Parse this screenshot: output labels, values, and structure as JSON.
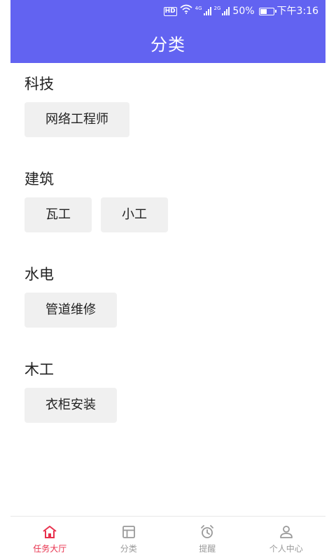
{
  "status_bar": {
    "hd": "HD",
    "net1": "4G",
    "net2": "2G",
    "battery_percent": "50%",
    "battery_level": 0.5,
    "time": "下午3:16"
  },
  "header": {
    "title": "分类"
  },
  "sections": [
    {
      "title": "科技",
      "items": [
        "网络工程师"
      ]
    },
    {
      "title": "建筑",
      "items": [
        "瓦工",
        "小工"
      ]
    },
    {
      "title": "水电",
      "items": [
        "管道维修"
      ]
    },
    {
      "title": "木工",
      "items": [
        "衣柜安装"
      ]
    }
  ],
  "tabs": [
    {
      "label": "任务大厅",
      "icon": "home-icon",
      "active": true
    },
    {
      "label": "分类",
      "icon": "grid-icon",
      "active": false
    },
    {
      "label": "提醒",
      "icon": "alarm-clock-icon",
      "active": false
    },
    {
      "label": "个人中心",
      "icon": "user-icon",
      "active": false
    }
  ],
  "colors": {
    "primary": "#6263f1",
    "active_tab": "#e8314d",
    "inactive_tab": "#9a9a9a",
    "tag_bg": "#f0f0f0"
  }
}
